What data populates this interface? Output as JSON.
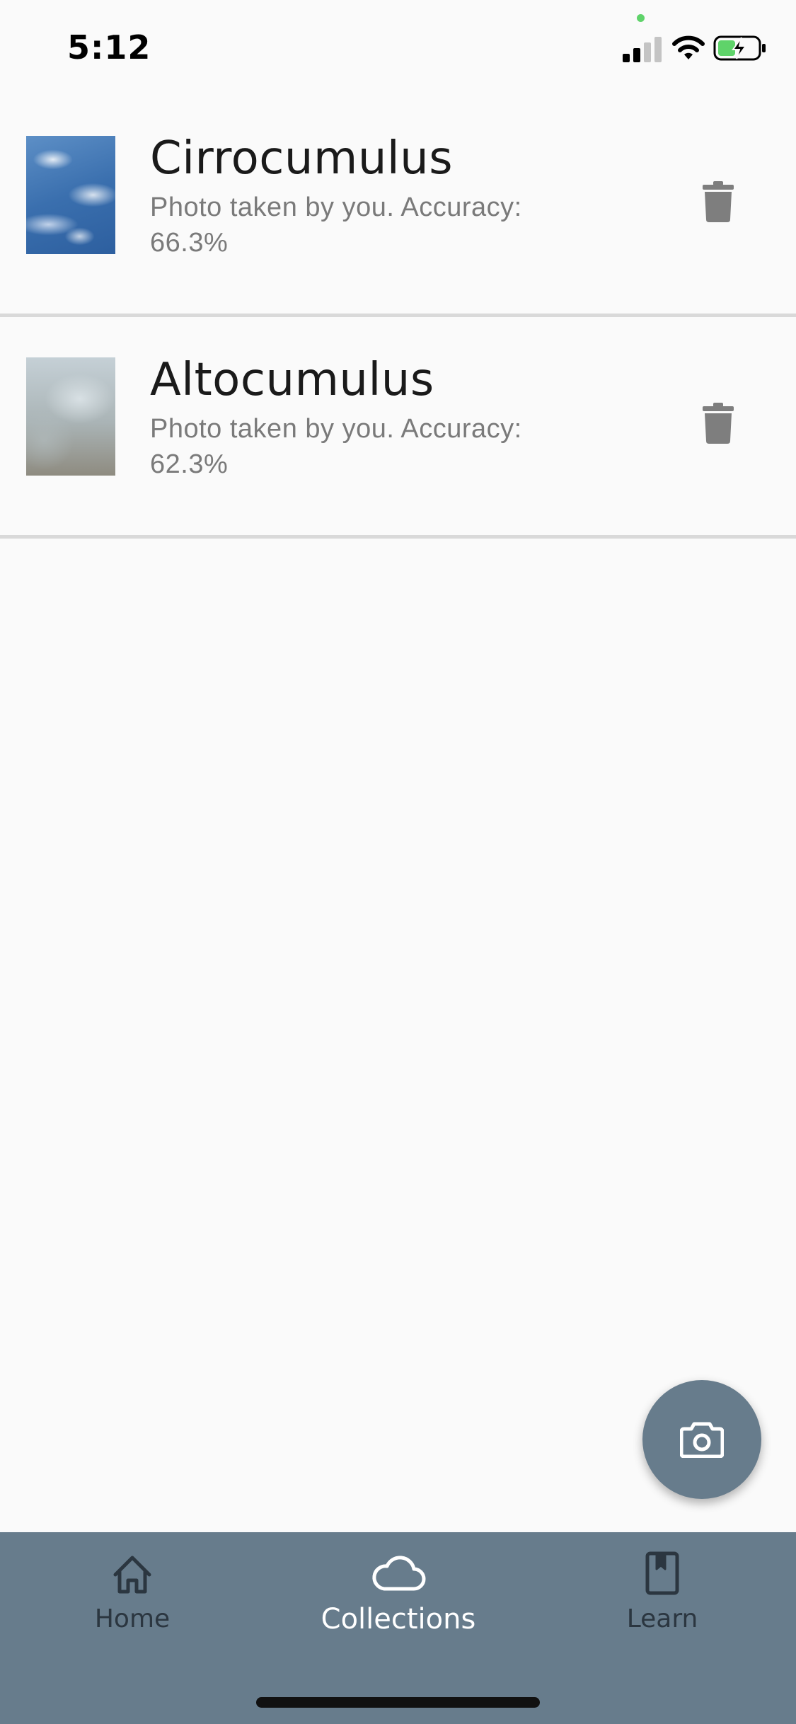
{
  "status_bar": {
    "time": "5:12"
  },
  "collection": {
    "items": [
      {
        "title": "Cirrocumulus",
        "subtitle": "Photo taken by you. Accuracy: 66.3%",
        "thumbnail_icon": "cloud-photo"
      },
      {
        "title": "Altocumulus",
        "subtitle": "Photo taken by you. Accuracy: 62.3%",
        "thumbnail_icon": "cloud-photo"
      }
    ]
  },
  "fab": {
    "icon": "camera-icon"
  },
  "bottom_nav": {
    "items": [
      {
        "label": "Home",
        "icon": "home-icon",
        "active": false
      },
      {
        "label": "Collections",
        "icon": "cloud-icon",
        "active": true
      },
      {
        "label": "Learn",
        "icon": "book-icon",
        "active": false
      }
    ]
  },
  "colors": {
    "nav_background": "#677c8c",
    "fab_background": "#677c8c",
    "active_label": "#ffffff",
    "inactive_label": "#2b3640",
    "title_text": "#1a1a1a",
    "subtitle_text": "#7a7a7a",
    "divider": "#d9d9d9",
    "battery_charge": "#5fd36a"
  }
}
